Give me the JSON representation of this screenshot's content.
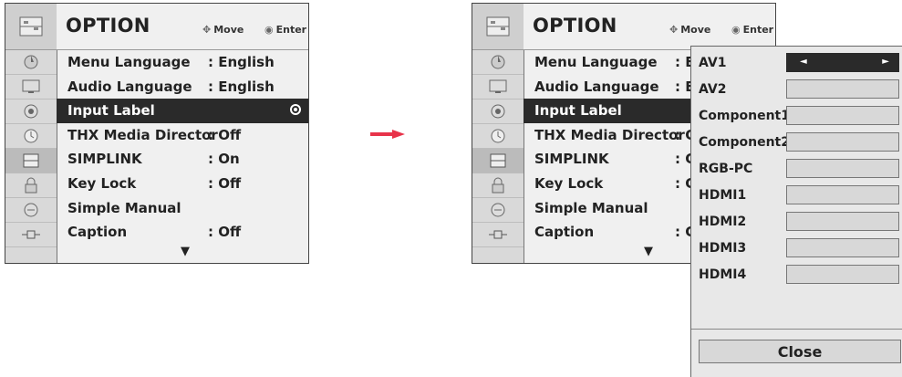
{
  "menu": {
    "title": "OPTION",
    "hint_move": "Move",
    "hint_enter": "Enter",
    "items": [
      {
        "label": "Menu Language",
        "value": ": English"
      },
      {
        "label": "Audio Language",
        "value": ": English"
      },
      {
        "label": "Input Label",
        "value": ""
      },
      {
        "label": "THX Media Director",
        "value": ": Off"
      },
      {
        "label": "SIMPLINK",
        "value": ": On"
      },
      {
        "label": "Key Lock",
        "value": ": Off"
      },
      {
        "label": "Simple Manual",
        "value": ""
      },
      {
        "label": "Caption",
        "value": ": Off"
      }
    ],
    "selected_index": 2
  },
  "right_menu": {
    "items": [
      {
        "label": "Menu Language",
        "value": ": English"
      },
      {
        "label": "Audio Language",
        "value": ": E"
      },
      {
        "label": "Input Label",
        "value": ""
      },
      {
        "label": "THX Media Director",
        "value": ": C"
      },
      {
        "label": "SIMPLINK",
        "value": ": C"
      },
      {
        "label": "Key Lock",
        "value": ": C"
      },
      {
        "label": "Simple Manual",
        "value": ""
      },
      {
        "label": "Caption",
        "value": ": C"
      }
    ]
  },
  "input_label_popup": {
    "inputs": [
      {
        "label": "AV1",
        "selected": true
      },
      {
        "label": "AV2",
        "selected": false
      },
      {
        "label": "Component1",
        "selected": false
      },
      {
        "label": "Component2",
        "selected": false
      },
      {
        "label": "RGB-PC",
        "selected": false
      },
      {
        "label": "HDMI1",
        "selected": false
      },
      {
        "label": "HDMI2",
        "selected": false
      },
      {
        "label": "HDMI3",
        "selected": false
      },
      {
        "label": "HDMI4",
        "selected": false
      }
    ],
    "close_label": "Close"
  },
  "colors": {
    "arrow": "#e8334a",
    "selected_row": "#2a2a2a"
  }
}
